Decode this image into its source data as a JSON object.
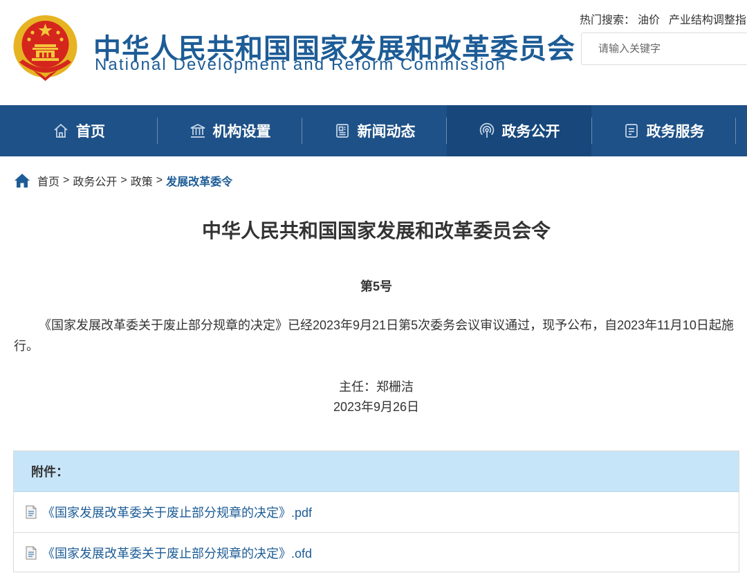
{
  "header": {
    "brand_cn": "中华人民共和国国家发展和改革委员会",
    "brand_en": "National Development and Reform Commission",
    "emblem_icon": "national-emblem",
    "hot_search_label": "热门搜索：",
    "hot_search_terms": [
      "油价",
      "产业结构调整指"
    ],
    "search_placeholder": "请输入关键字"
  },
  "nav": {
    "items": [
      {
        "label": "首页",
        "icon": "home-outline-icon"
      },
      {
        "label": "机构设置",
        "icon": "institution-icon"
      },
      {
        "label": "新闻动态",
        "icon": "news-icon"
      },
      {
        "label": "政务公开",
        "icon": "broadcast-icon",
        "active": true
      },
      {
        "label": "政务服务",
        "icon": "service-icon"
      }
    ],
    "bg_color": "#1e5187",
    "active_color": "#17477b"
  },
  "breadcrumb": {
    "items": [
      "首页",
      "政务公开",
      "政策"
    ],
    "separator": ">",
    "current": "发展改革委令"
  },
  "article": {
    "title": "中华人民共和国国家发展和改革委员会令",
    "number": "第5号",
    "body": "《国家发展改革委关于废止部分规章的决定》已经2023年9月21日第5次委务会议审议通过，现予公布，自2023年11月10日起施行。",
    "signer": "主任：郑栅洁",
    "date": "2023年9月26日"
  },
  "attachments": {
    "heading": "附件：",
    "files": [
      {
        "name": "《国家发展改革委关于废止部分规章的决定》.pdf",
        "icon": "document-icon"
      },
      {
        "name": "《国家发展改革委关于废止部分规章的决定》.ofd",
        "icon": "document-icon"
      }
    ],
    "header_bg": "#c7e5f9",
    "link_color": "#1d5c96"
  }
}
